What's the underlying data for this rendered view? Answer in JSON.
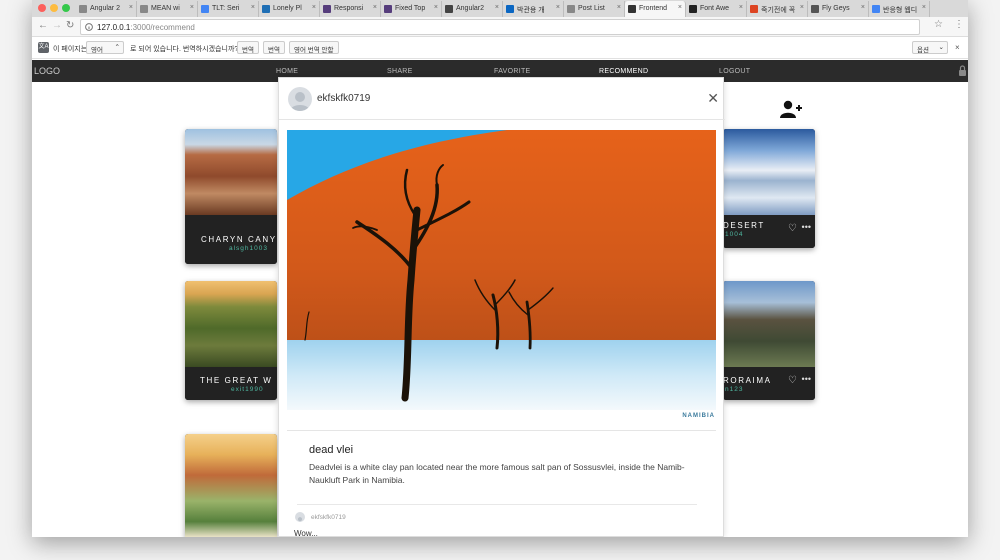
{
  "browser": {
    "tabs": [
      {
        "label": "Angular 2",
        "icon": "doc-icon",
        "color": "#888"
      },
      {
        "label": "MEAN wi",
        "icon": "doc-icon",
        "color": "#888"
      },
      {
        "label": "TLT: Seri",
        "icon": "google-icon",
        "color": "#4285f4"
      },
      {
        "label": "Lonely Pl",
        "icon": "lp-icon",
        "color": "#1f6fb5"
      },
      {
        "label": "Responsi",
        "icon": "bootstrap-icon",
        "color": "#563d7c"
      },
      {
        "label": "Fixed Top",
        "icon": "bootstrap-icon",
        "color": "#563d7c"
      },
      {
        "label": "Angular2",
        "icon": "page-icon",
        "color": "#444"
      },
      {
        "label": "박관용 개",
        "icon": "linkedin-icon",
        "color": "#0a66c2"
      },
      {
        "label": "Post List",
        "icon": "doc-icon",
        "color": "#888"
      },
      {
        "label": "Frontend",
        "icon": "tools-icon",
        "color": "#333"
      },
      {
        "label": "Font Awe",
        "icon": "flag-icon",
        "color": "#222"
      },
      {
        "label": "죽기전에 꼭",
        "icon": "e-icon",
        "color": "#d42"
      },
      {
        "label": "Fly Geys",
        "icon": "wiki-icon",
        "color": "#555"
      },
      {
        "label": "반응형 웹디",
        "icon": "google-icon",
        "color": "#4285f4"
      }
    ],
    "url_host": "127.0.0.1",
    "url_path": ":3000/recommend"
  },
  "translate_bar": {
    "page_is_in": "이 페이지는",
    "language": "영어",
    "question": "로 되어 있습니다. 번역하시겠습니까?",
    "btn_original": "번역",
    "btn_translate": "번역",
    "btn_always": "영어 번역 안함",
    "options": "옵션"
  },
  "nav": {
    "logo": "LOGO",
    "links": [
      "HOME",
      "SHARE",
      "FAVORITE",
      "RECOMMEND",
      "LOGOUT"
    ],
    "active": "RECOMMEND"
  },
  "cards": [
    {
      "title": "CHARYN CANY",
      "user": "alsgh1003"
    },
    {
      "title": "DESERT",
      "user": "1004"
    },
    {
      "title": "THE GREAT W",
      "user": "exit1990"
    },
    {
      "title": "RORAIMA",
      "user": "n123"
    }
  ],
  "modal": {
    "username": "ekfskfk0719",
    "location": "NAMIBIA",
    "title": "dead vlei",
    "description": "Deadvlei is a white clay pan located near the more famous salt pan of Sossusvlei, inside the Namib-Naukluft Park in Namibia.",
    "comment_user": "ekfskfk0719",
    "comment_text": "Wow..."
  }
}
